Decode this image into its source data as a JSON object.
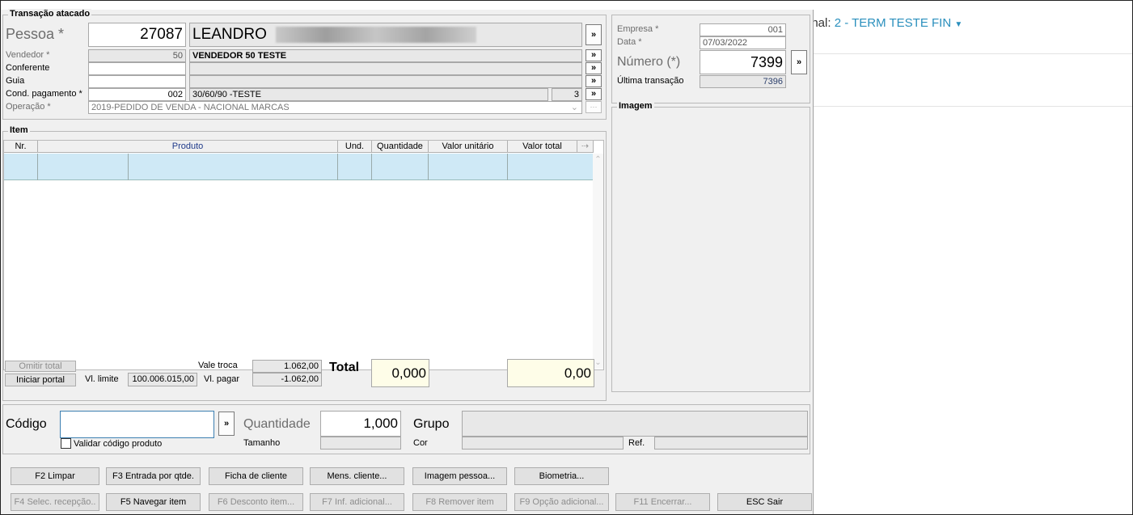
{
  "background": {
    "terminal_label": "inal:",
    "terminal_value": "2 - TERM TESTE FIN",
    "caret_icon": "caret-down-icon"
  },
  "header": {
    "group_title": "Transação atacado",
    "pessoa_label": "Pessoa *",
    "pessoa_code": "27087",
    "pessoa_name": "LEANDRO",
    "vendedor_label": "Vendedor *",
    "vendedor_code": "50",
    "vendedor_name": "VENDEDOR 50 TESTE",
    "conferente_label": "Conferente",
    "conferente_code": "",
    "conferente_name": "",
    "guia_label": "Guia",
    "guia_code": "",
    "guia_name": "",
    "cond_label": "Cond. pagamento *",
    "cond_code": "002",
    "cond_name": "30/60/90 -TESTE",
    "cond_count": "3",
    "operacao_label": "Operação *",
    "operacao_value": "2019-PEDIDO DE VENDA - NACIONAL MARCAS",
    "lookup_label": "»"
  },
  "empresa": {
    "empresa_label": "Empresa *",
    "empresa_value": "001",
    "data_label": "Data *",
    "data_value": "07/03/2022",
    "numero_label": "Número (*)",
    "numero_value": "7399",
    "ultima_label": "Última transação",
    "ultima_value": "7396"
  },
  "imagem": {
    "title": "Imagem"
  },
  "item": {
    "title": "Item",
    "columns": [
      "Nr.",
      "Produto",
      "Und.",
      "Quantidade",
      "Valor unitário",
      "Valor total"
    ],
    "column_config_icon": "column-config-icon"
  },
  "totals": {
    "omitir_label": "Omitir total",
    "iniciar_label": "Iniciar portal",
    "vl_limite_label": "Vl. limite",
    "vl_limite_value": "100.006.015,00",
    "vale_troca_label": "Vale troca",
    "vale_troca_value": "1.062,00",
    "vl_pagar_label": "Vl. pagar",
    "vl_pagar_value": "-1.062,00",
    "total_label": "Total",
    "total_qty": "0,000",
    "total_value": "0,00"
  },
  "entry": {
    "codigo_label": "Código",
    "codigo_value": "",
    "validar_label": "Validar código produto",
    "quantidade_label": "Quantidade",
    "quantidade_value": "1,000",
    "tamanho_label": "Tamanho",
    "grupo_label": "Grupo",
    "cor_label": "Cor",
    "ref_label": "Ref."
  },
  "buttons_row1": [
    "F2 Limpar",
    "F3 Entrada por qtde.",
    "Ficha de cliente",
    "Mens. cliente...",
    "Imagem pessoa...",
    "Biometria..."
  ],
  "buttons_row2": [
    "F4 Selec. recepção..",
    "F5 Navegar item",
    "F6 Desconto item...",
    "F7 Inf. adicional...",
    "F8 Remover item",
    "F9 Opção adicional...",
    "F11 Encerrar...",
    "ESC Sair"
  ]
}
